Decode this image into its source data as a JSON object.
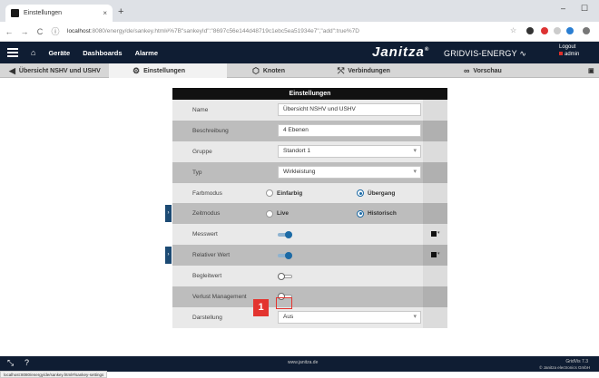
{
  "browser": {
    "tab_title": "Einstellungen",
    "tab_close": "×",
    "new_tab": "+",
    "url_host": "localhost",
    "url_rest": ":8080/energy/de/sankey.html#%7B\"sankeyId\":\"8697c56e144d48719c1ebc5ea51934e7\",\"add\":true%7D",
    "back": "←",
    "forward": "→",
    "reload": "C",
    "minimize": "–",
    "maximize": "☐",
    "status_url": "localhost:8080/energy/de/sankey.html#/sankey-settings"
  },
  "header": {
    "nav": [
      "Geräte",
      "Dashboards",
      "Alarme"
    ],
    "brand": "Janitza",
    "brand_mark": "®",
    "product": "GRIDVIS-ENERGY",
    "logout_label": "Logout",
    "user": "admin"
  },
  "subbar": {
    "back_label": "Übersicht NSHV und USHV",
    "tabs": [
      "Einstellungen",
      "Knoten",
      "Verbindungen",
      "Vorschau"
    ]
  },
  "panel": {
    "title": "Einstellungen",
    "rows": {
      "name": {
        "label": "Name",
        "value": "Übersicht NSHV und USHV"
      },
      "beschreibung": {
        "label": "Beschreibung",
        "value": "4 Ebenen"
      },
      "gruppe": {
        "label": "Gruppe",
        "value": "Standort 1"
      },
      "typ": {
        "label": "Typ",
        "value": "Wirkleistung"
      },
      "farbmodus": {
        "label": "Farbmodus",
        "opt1": "Einfarbig",
        "opt2": "Übergang",
        "selected": "Übergang"
      },
      "zeitmodus": {
        "label": "Zeitmodus",
        "opt1": "Live",
        "opt2": "Historisch",
        "selected": "Historisch"
      },
      "messwert": {
        "label": "Messwert",
        "on": true
      },
      "relativer_wert": {
        "label": "Relativer Wert",
        "on": true
      },
      "begleitwert": {
        "label": "Begleitwert",
        "on": false
      },
      "verlust": {
        "label": "Verlust Management",
        "on": false
      },
      "darstellung": {
        "label": "Darstellung",
        "value": "Aus"
      }
    }
  },
  "marker": {
    "number": "1",
    "color": "#e3342f"
  },
  "footer": {
    "website": "www.janitza.de",
    "version": "GridVis 7.3",
    "copyright": "© Janitza electronics GmbH"
  },
  "colors": {
    "dark_navy": "#0f1d33",
    "accent_blue": "#1c6aa5",
    "marker_red": "#e3342f"
  }
}
